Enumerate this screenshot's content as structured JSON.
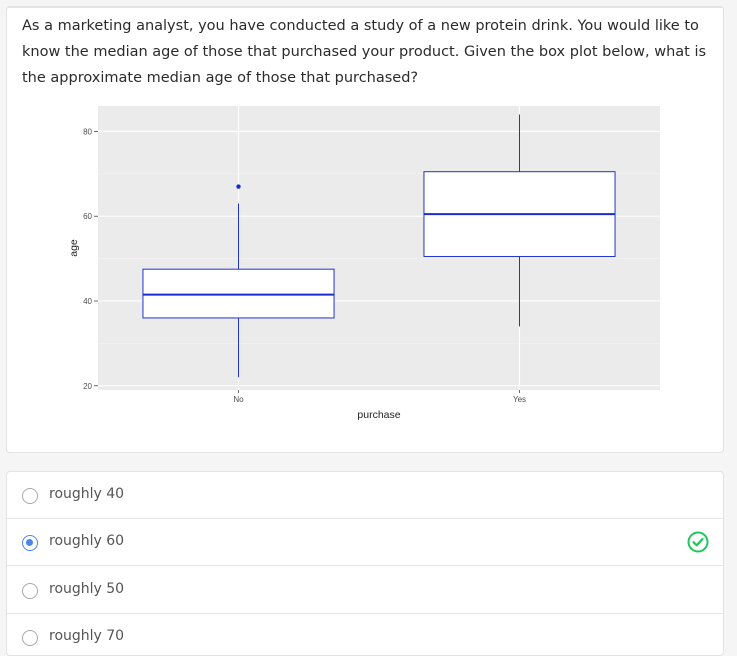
{
  "question": {
    "text": "As a marketing analyst, you have conducted a study of a new protein drink. You would like to know the median age of those that purchased your product. Given the box plot below, what is the approximate median age of those that purchased?"
  },
  "chart_data": {
    "type": "boxplot",
    "xlabel": "purchase",
    "ylabel": "age",
    "categories": [
      "No",
      "Yes"
    ],
    "y_ticks": [
      20,
      40,
      60,
      80
    ],
    "ylim": [
      19,
      86
    ],
    "boxes": [
      {
        "category": "No",
        "whisker_low": 22,
        "q1": 36,
        "median": 41.5,
        "q3": 47.5,
        "whisker_high": 63,
        "outliers": [
          67
        ]
      },
      {
        "category": "Yes",
        "whisker_low": 34,
        "q1": 50.5,
        "median": 60.5,
        "q3": 70.5,
        "whisker_high": 84,
        "outliers": []
      }
    ],
    "colors": {
      "panel": "#ebebeb",
      "grid": "#ffffff",
      "box_stroke": "#2233cc",
      "median": "#1a2bd0"
    }
  },
  "options": [
    {
      "label": "roughly 40",
      "selected": false,
      "correct": false
    },
    {
      "label": "roughly 60",
      "selected": true,
      "correct": true
    },
    {
      "label": "roughly 50",
      "selected": false,
      "correct": false
    },
    {
      "label": "roughly 70",
      "selected": false,
      "correct": false
    }
  ],
  "icons": {
    "correct": "check-circle-icon"
  }
}
